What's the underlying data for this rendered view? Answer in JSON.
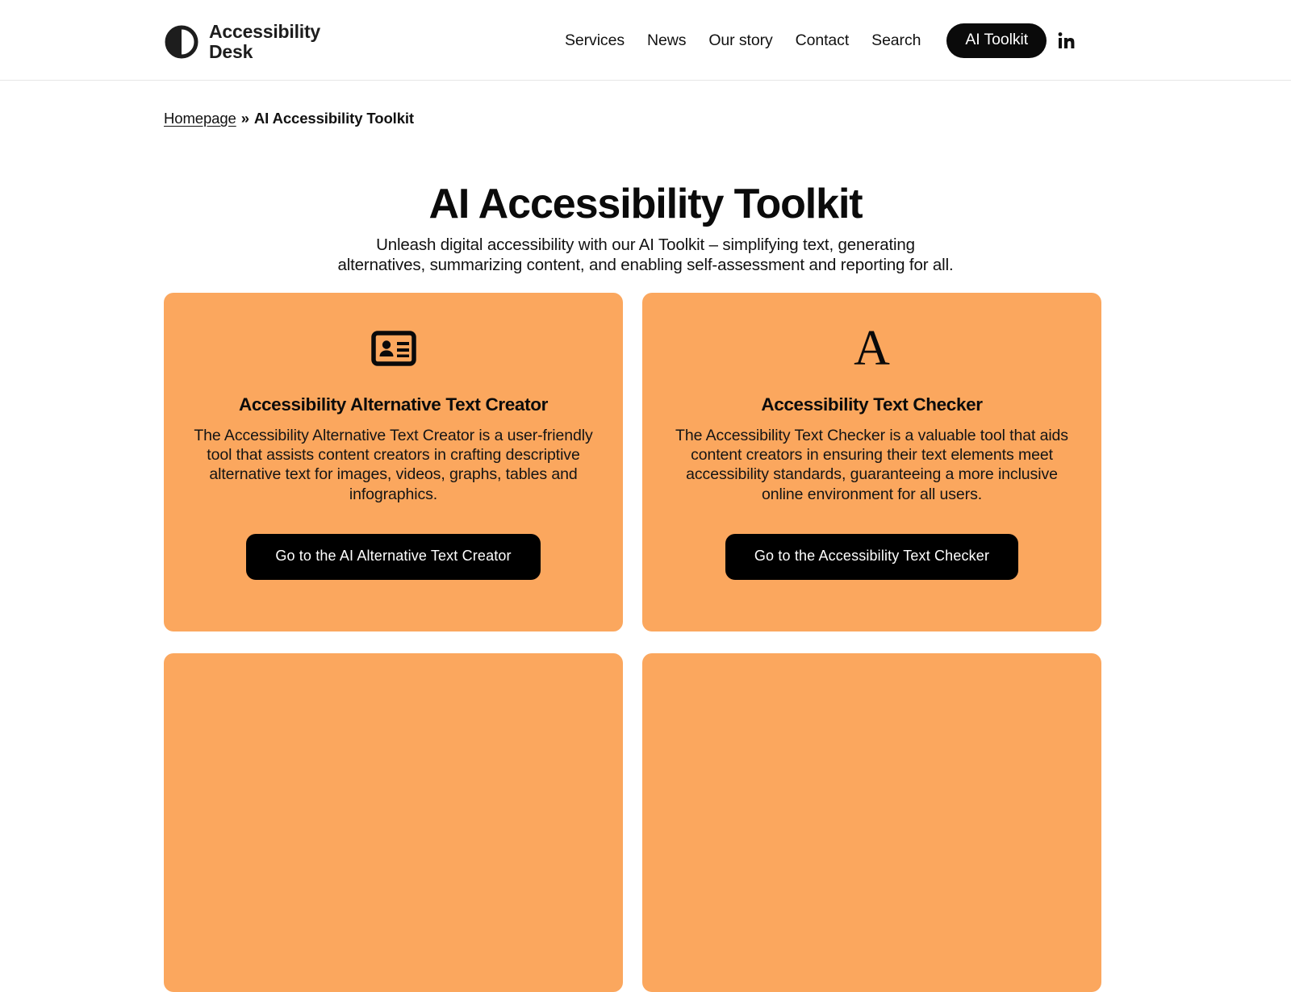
{
  "header": {
    "logo": {
      "icon": "accessibility-circle-logo",
      "text": "Accessibility\nDesk"
    },
    "nav_items": [
      {
        "label": "Services"
      },
      {
        "label": "News"
      },
      {
        "label": "Our story"
      },
      {
        "label": "Contact"
      },
      {
        "label": "Search"
      }
    ],
    "cta": {
      "label": "AI Toolkit"
    },
    "social": {
      "icon": "linkedin-icon",
      "label": "LinkedIn"
    }
  },
  "breadcrumb": {
    "home_label": "Homepage",
    "separator": "»",
    "current_label": "AI Accessibility Toolkit"
  },
  "hero": {
    "title": "AI Accessibility Toolkit",
    "subtitle": "Unleash digital accessibility with our AI Toolkit – simplifying text, generating alternatives, summarizing content, and enabling self-assessment and reporting for all."
  },
  "cards": [
    {
      "icon": "id-card-icon",
      "title": "Accessibility Alternative Text Creator",
      "body": "The Accessibility Alternative Text Creator is a user-friendly tool that assists content creators in crafting descriptive alternative text for images, videos, graphs, tables and infographics.",
      "button_label": "Go to the AI Alternative Text Creator"
    },
    {
      "icon": "letter-a-icon",
      "icon_glyph": "A",
      "title": "Accessibility Text Checker",
      "body": "The Accessibility Text Checker is a valuable tool that aids content creators in ensuring their text elements meet accessibility standards, guaranteeing a more inclusive online environment for all users.",
      "button_label": "Go to the Accessibility Text Checker"
    }
  ],
  "colors": {
    "card_background": "#fba75e",
    "button_background": "#000000",
    "text": "#0b0b0b",
    "header_border": "#e6e6e6"
  }
}
